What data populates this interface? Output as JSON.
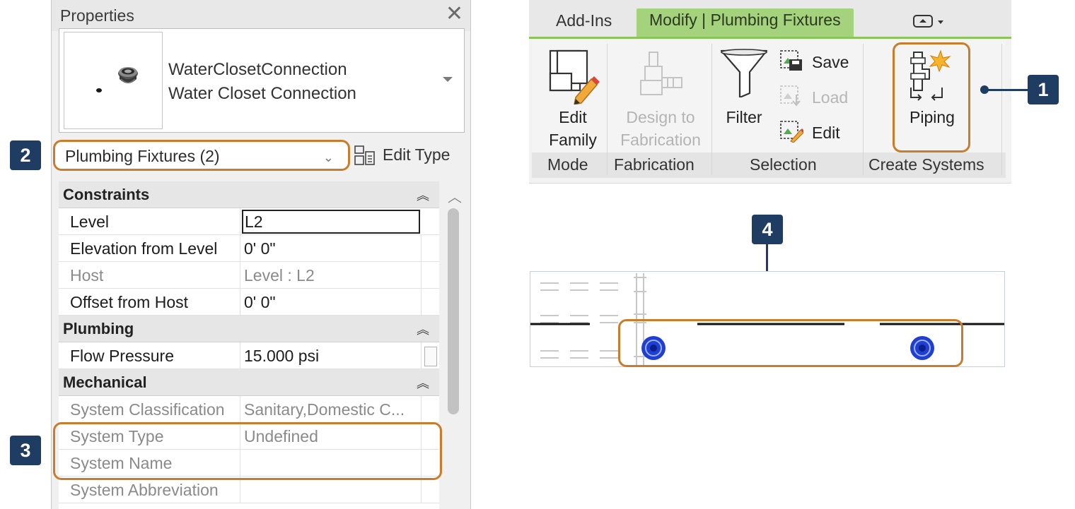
{
  "properties": {
    "title": "Properties",
    "type_family": "WaterClosetConnection",
    "type_name": "Water Closet Connection",
    "selector": "Plumbing Fixtures (2)",
    "edit_type": "Edit Type",
    "sections": [
      {
        "label": "Constraints",
        "toggle": "≈"
      },
      {
        "label": "Plumbing",
        "toggle": "≈"
      },
      {
        "label": "Mechanical",
        "toggle": "≈"
      }
    ],
    "rows": {
      "level": {
        "name": "Level",
        "value": "L2"
      },
      "elevation": {
        "name": "Elevation from Level",
        "value": "0'  0\""
      },
      "host": {
        "name": "Host",
        "value": "Level : L2"
      },
      "offset": {
        "name": "Offset from Host",
        "value": "0'  0\""
      },
      "flow_pressure": {
        "name": "Flow Pressure",
        "value": "15.000 psi"
      },
      "system_classification": {
        "name": "System Classification",
        "value": "Sanitary,Domestic C..."
      },
      "system_type": {
        "name": "System Type",
        "value": "Undefined"
      },
      "system_name": {
        "name": "System Name",
        "value": ""
      },
      "system_abbreviation": {
        "name": "System Abbreviation",
        "value": ""
      }
    }
  },
  "ribbon": {
    "tabs": [
      "Add-Ins",
      "Modify | Plumbing Fixtures"
    ],
    "quick_access": "▾",
    "buttons": {
      "edit_family": [
        "Edit",
        "Family"
      ],
      "design_to_fabrication": [
        "Design to",
        "Fabrication"
      ],
      "filter": "Filter",
      "save": "Save",
      "load": "Load",
      "edit": "Edit",
      "piping": "Piping"
    },
    "panels": [
      "Mode",
      "Fabrication",
      "Selection",
      "Create Systems"
    ]
  },
  "callouts": [
    "1",
    "2",
    "3",
    "4"
  ],
  "colors": {
    "callout": "#1f3d63",
    "highlight": "#c97d2c",
    "active_tab": "#a5d27c",
    "fixture": "#1e3fd1"
  }
}
